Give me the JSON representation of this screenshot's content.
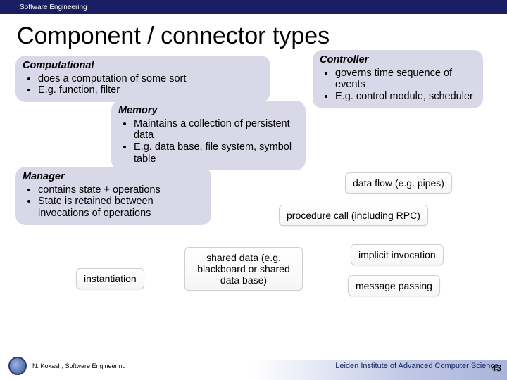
{
  "topbar": {
    "label": "Software Engineering"
  },
  "title": "Component / connector types",
  "boxes": {
    "computational": {
      "head": "Computational",
      "items": [
        "does a computation of some sort",
        "E.g. function, filter"
      ]
    },
    "controller": {
      "head": "Controller",
      "items": [
        "governs time sequence of events",
        "E.g. control module, scheduler"
      ]
    },
    "memory": {
      "head": "Memory",
      "items": [
        "Maintains a collection of persistent data",
        "E.g. data base, file system, symbol table"
      ]
    },
    "manager": {
      "head": "Manager",
      "items": [
        "contains state + operations",
        "State is retained between invocations of operations"
      ]
    }
  },
  "chips": {
    "dataflow": "data flow (e.g. pipes)",
    "procedure": "procedure call (including RPC)",
    "implicit": "implicit invocation",
    "instantiation": "instantiation",
    "shared": "shared data (e.g. blackboard or shared data base)",
    "message": "message passing"
  },
  "footer": {
    "credit": "N. Kokash, Software Engineering",
    "affiliation": "Leiden Institute of Advanced Computer Science",
    "page": "43"
  }
}
